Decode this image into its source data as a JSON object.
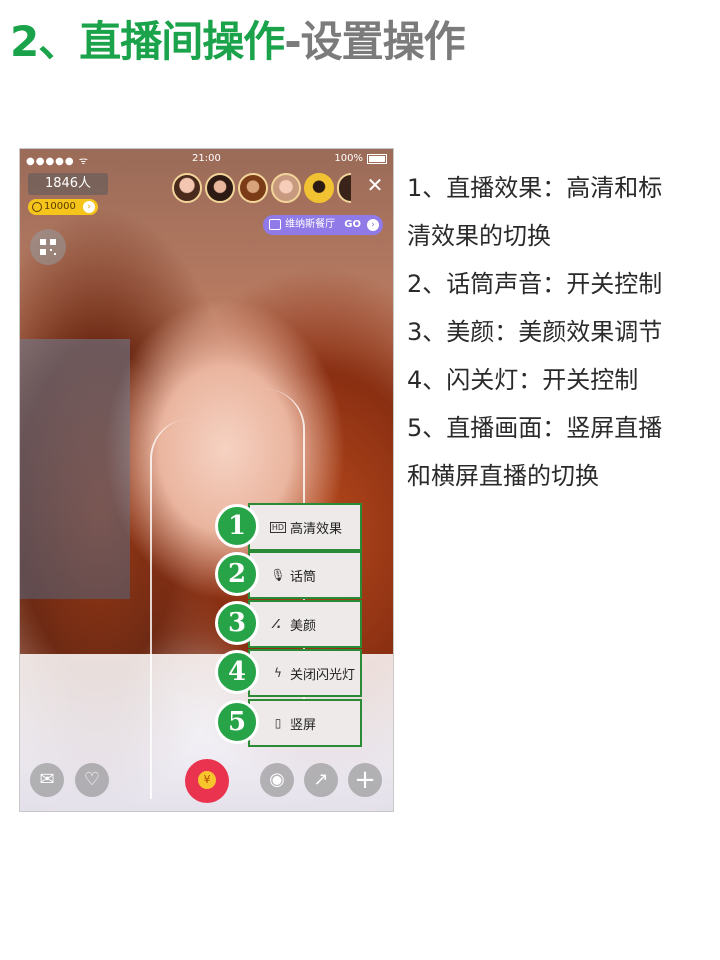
{
  "title": {
    "part_green": "2、直播间操作",
    "part_gray": "-设置操作"
  },
  "phone": {
    "status_bar": {
      "signal": "●●●●● ᯤ",
      "time": "21:00",
      "battery": "100%"
    },
    "viewer_count": "1846人",
    "coins": "10000",
    "venue_tag": {
      "label": "维纳斯餐厅",
      "go": "GO"
    },
    "settings_menu": [
      {
        "number": "1",
        "icon": "hd-icon",
        "glyph": "HD",
        "label": "高清效果"
      },
      {
        "number": "2",
        "icon": "microphone-icon",
        "glyph": "🎙",
        "label": "话筒"
      },
      {
        "number": "3",
        "icon": "beauty-wand-icon",
        "glyph": "⁄.",
        "label": "美颜"
      },
      {
        "number": "4",
        "icon": "flash-off-icon",
        "glyph": "ϟ",
        "label": "关闭闪光灯"
      },
      {
        "number": "5",
        "icon": "portrait-screen-icon",
        "glyph": "▯",
        "label": "竖屏"
      }
    ],
    "bottom_bar": {
      "mail": "✉",
      "heart": "♡",
      "gift": "¥",
      "camera": "◉",
      "share": "↗",
      "plus": "+"
    }
  },
  "description": [
    "1、直播效果：高清和标",
    "清效果的切换",
    "2、话筒声音：开关控制",
    "3、美颜：美颜效果调节",
    "4、闪关灯：开关控制",
    "5、直播画面：竖屏直播",
    "和横屏直播的切换"
  ]
}
